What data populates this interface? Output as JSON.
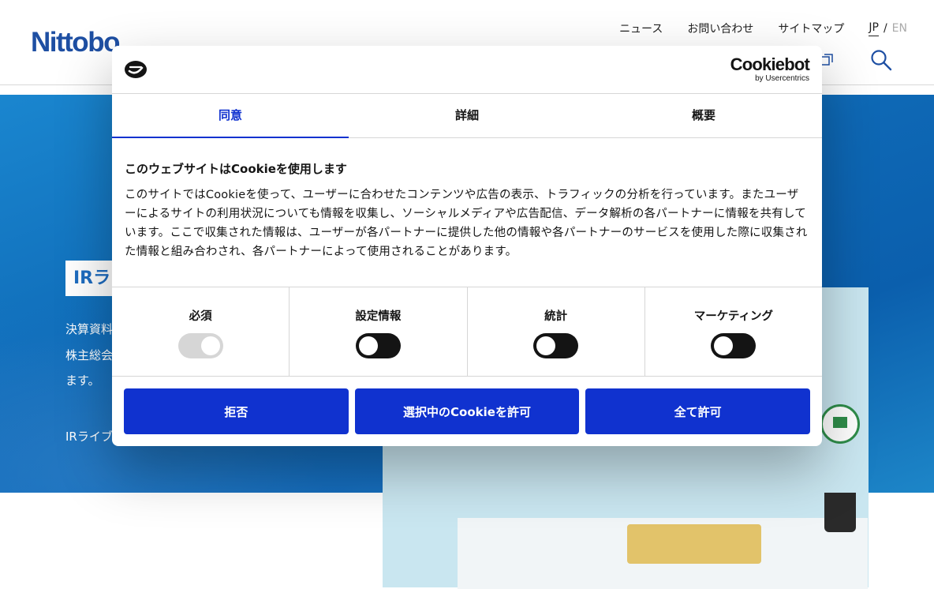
{
  "site": {
    "logo": "Nittobo",
    "nav": [
      "ニュース",
      "お問い合わせ",
      "サイトマップ"
    ],
    "lang_jp": "JP",
    "lang_sep": "/",
    "lang_en": "EN",
    "hero_title": "IRラ",
    "hero_lines": [
      "決算資料",
      "株主総会",
      "ます。",
      "IRライブ"
    ]
  },
  "cookie_dialog": {
    "provider_name": "Cookiebot",
    "provider_sub": "by Usercentrics",
    "tabs": [
      {
        "label": "同意",
        "active": true
      },
      {
        "label": "詳細",
        "active": false
      },
      {
        "label": "概要",
        "active": false
      }
    ],
    "heading": "このウェブサイトはCookieを使用します",
    "description": "このサイトではCookieを使って、ユーザーに合わせたコンテンツや広告の表示、トラフィックの分析を行っています。またユーザーによるサイトの利用状況についても情報を収集し、ソーシャルメディアや広告配信、データ解析の各パートナーに情報を共有しています。ここで収集された情報は、ユーザーが各パートナーに提供した他の情報や各パートナーのサービスを使用した際に収集された情報と組み合わされ、各パートナーによって使用されることがあります。",
    "toggles": [
      {
        "label": "必須",
        "state": "on-disabled"
      },
      {
        "label": "設定情報",
        "state": "off"
      },
      {
        "label": "統計",
        "state": "off"
      },
      {
        "label": "マーケティング",
        "state": "off"
      }
    ],
    "buttons": {
      "deny": "拒否",
      "allow_selection": "選択中のCookieを許可",
      "allow_all": "全て許可"
    }
  },
  "colors": {
    "accent": "#1032cf",
    "brand": "#1e4fa3",
    "hero_blue": "#0e68b5"
  }
}
